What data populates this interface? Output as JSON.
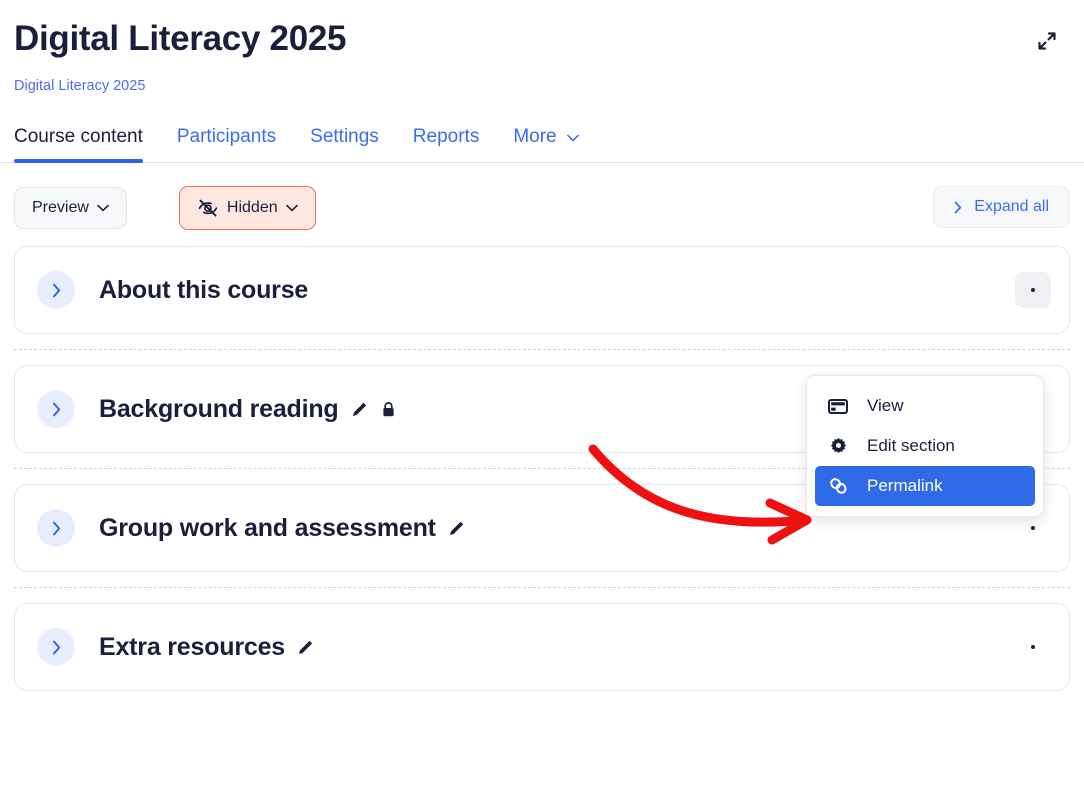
{
  "header": {
    "title": "Digital Literacy 2025",
    "breadcrumb": "Digital Literacy 2025",
    "expand_window_icon": "expand-diagonal-icon"
  },
  "tabs": [
    {
      "label": "Course content",
      "active": true
    },
    {
      "label": "Participants",
      "active": false
    },
    {
      "label": "Settings",
      "active": false
    },
    {
      "label": "Reports",
      "active": false
    },
    {
      "label": "More",
      "active": false,
      "caret": "chevron-down-icon"
    }
  ],
  "toolbar": {
    "preview_label": "Preview",
    "preview_caret": "chevron-down-icon",
    "hidden_label": "Hidden",
    "hidden_icon": "eye-slash-icon",
    "hidden_caret": "chevron-down-icon",
    "expand_all_label": "Expand all",
    "expand_all_icon": "chevron-right-icon"
  },
  "colors": {
    "accent_blue": "#2f5ff0",
    "link_blue": "#3b6bf5",
    "title_navy": "#1b1f3b",
    "hidden_border": "#f4704f",
    "hidden_fill": "#fde7e1",
    "chevron_circle": "#e8edfb",
    "menu_selected": "#2f6ae8",
    "annotation_red": "#ee1111"
  },
  "sections": [
    {
      "title": "About this course",
      "chevron": "chevron-right-icon",
      "edit_icon": null,
      "lock_icon": null,
      "menu_open": true
    },
    {
      "title": "Background reading",
      "chevron": "chevron-right-icon",
      "edit_icon": "pencil-icon",
      "lock_icon": "lock-icon",
      "menu_open": false
    },
    {
      "title": "Group work and assessment",
      "chevron": "chevron-right-icon",
      "edit_icon": "pencil-icon",
      "lock_icon": null,
      "menu_open": false
    },
    {
      "title": "Extra resources",
      "chevron": "chevron-right-icon",
      "edit_icon": "pencil-icon",
      "lock_icon": null,
      "menu_open": false
    }
  ],
  "dropdown": {
    "items": [
      {
        "label": "View",
        "icon": "card-view-icon",
        "selected": false
      },
      {
        "label": "Edit section",
        "icon": "gear-icon",
        "selected": false
      },
      {
        "label": "Permalink",
        "icon": "link-chain-icon",
        "selected": true
      }
    ]
  },
  "annotation": {
    "type": "curved-arrow",
    "color": "#ee1111",
    "points_to": "Permalink"
  }
}
